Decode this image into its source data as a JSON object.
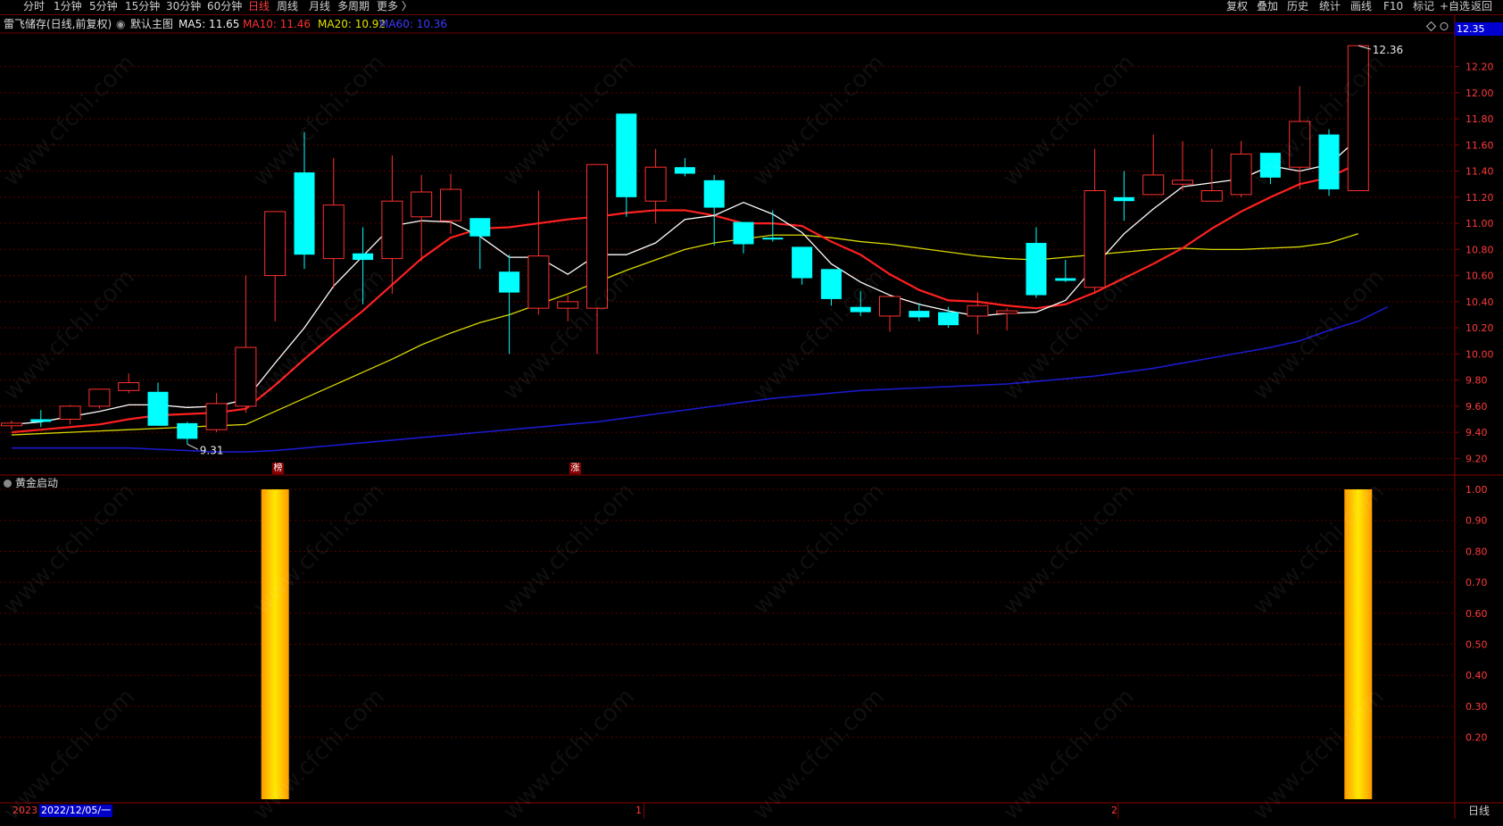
{
  "toolbar": {
    "periods": [
      "分时",
      "1分钟",
      "5分钟",
      "15分钟",
      "30分钟",
      "60分钟",
      "日线",
      "周线",
      "月线",
      "多周期",
      "更多 〉"
    ],
    "active_period": "日线",
    "right_buttons": [
      "复权",
      "叠加",
      "历史",
      "统计",
      "画线",
      "F10",
      "标记",
      "+自选",
      "返回"
    ]
  },
  "info": {
    "stock": "雷飞储存(日线,前复权)",
    "main_chart": "默认主图",
    "ma5": "MA5: 11.65",
    "ma10": "MA10: 11.46",
    "ma20": "MA20: 10.92",
    "ma60": "MA60: 10.36"
  },
  "current_price_box": "12.35",
  "annotations": {
    "high": "12.36",
    "low": "9.31"
  },
  "flags": [
    "榜",
    "涨"
  ],
  "sub_indicator": "黄金启动",
  "footer": {
    "year": "2023",
    "date": "2022/12/05/一",
    "month_1": "1",
    "month_2": "2",
    "period": "日线"
  },
  "colors": {
    "up": "#ff3030",
    "down": "#00ffff",
    "ma5": "#ffffff",
    "ma10": "#ff2020",
    "ma20": "#d8d800",
    "ma60": "#1a1acc",
    "bar": "#ffd000"
  },
  "watermark": "www.cfchi.com",
  "chart_data": [
    {
      "type": "candlestick",
      "y_ticks": [
        9.2,
        9.4,
        9.6,
        9.8,
        10.0,
        10.2,
        10.4,
        10.6,
        10.8,
        11.0,
        11.2,
        11.4,
        11.6,
        11.8,
        12.0,
        12.2
      ],
      "ylim": [
        9.1,
        12.45
      ],
      "candles": [
        {
          "o": 9.45,
          "h": 9.49,
          "l": 9.42,
          "c": 9.47
        },
        {
          "o": 9.5,
          "h": 9.57,
          "l": 9.44,
          "c": 9.48
        },
        {
          "o": 9.5,
          "h": 9.61,
          "l": 9.46,
          "c": 9.6
        },
        {
          "o": 9.6,
          "h": 9.73,
          "l": 9.58,
          "c": 9.73
        },
        {
          "o": 9.72,
          "h": 9.85,
          "l": 9.7,
          "c": 9.78
        },
        {
          "o": 9.71,
          "h": 9.78,
          "l": 9.45,
          "c": 9.45
        },
        {
          "o": 9.47,
          "h": 9.48,
          "l": 9.31,
          "c": 9.35
        },
        {
          "o": 9.42,
          "h": 9.7,
          "l": 9.4,
          "c": 9.62
        },
        {
          "o": 9.6,
          "h": 10.6,
          "l": 9.55,
          "c": 10.05
        },
        {
          "o": 10.6,
          "h": 11.09,
          "l": 10.25,
          "c": 11.09
        },
        {
          "o": 11.39,
          "h": 11.7,
          "l": 10.65,
          "c": 10.76
        },
        {
          "o": 10.73,
          "h": 11.5,
          "l": 10.5,
          "c": 11.14
        },
        {
          "o": 10.77,
          "h": 10.97,
          "l": 10.38,
          "c": 10.72
        },
        {
          "o": 10.73,
          "h": 11.52,
          "l": 10.46,
          "c": 11.17
        },
        {
          "o": 11.05,
          "h": 11.37,
          "l": 10.71,
          "c": 11.24
        },
        {
          "o": 11.02,
          "h": 11.38,
          "l": 10.92,
          "c": 11.26
        },
        {
          "o": 11.04,
          "h": 11.04,
          "l": 10.65,
          "c": 10.9
        },
        {
          "o": 10.63,
          "h": 10.76,
          "l": 10.0,
          "c": 10.47
        },
        {
          "o": 10.35,
          "h": 11.25,
          "l": 10.3,
          "c": 10.75
        },
        {
          "o": 10.35,
          "h": 10.45,
          "l": 10.25,
          "c": 10.4
        },
        {
          "o": 10.35,
          "h": 11.45,
          "l": 10.0,
          "c": 11.45
        },
        {
          "o": 11.84,
          "h": 11.84,
          "l": 11.05,
          "c": 11.2
        },
        {
          "o": 11.17,
          "h": 11.57,
          "l": 11.0,
          "c": 11.43
        },
        {
          "o": 11.43,
          "h": 11.5,
          "l": 11.36,
          "c": 11.38
        },
        {
          "o": 11.33,
          "h": 11.37,
          "l": 10.83,
          "c": 11.12
        },
        {
          "o": 11.01,
          "h": 11.01,
          "l": 10.77,
          "c": 10.84
        },
        {
          "o": 10.89,
          "h": 11.1,
          "l": 10.86,
          "c": 10.88
        },
        {
          "o": 10.82,
          "h": 10.82,
          "l": 10.53,
          "c": 10.58
        },
        {
          "o": 10.65,
          "h": 10.65,
          "l": 10.37,
          "c": 10.42
        },
        {
          "o": 10.36,
          "h": 10.48,
          "l": 10.29,
          "c": 10.32
        },
        {
          "o": 10.29,
          "h": 10.44,
          "l": 10.17,
          "c": 10.44
        },
        {
          "o": 10.33,
          "h": 10.39,
          "l": 10.25,
          "c": 10.28
        },
        {
          "o": 10.32,
          "h": 10.36,
          "l": 10.2,
          "c": 10.22
        },
        {
          "o": 10.29,
          "h": 10.47,
          "l": 10.15,
          "c": 10.37
        },
        {
          "o": 10.31,
          "h": 10.35,
          "l": 10.18,
          "c": 10.33
        },
        {
          "o": 10.85,
          "h": 10.97,
          "l": 10.43,
          "c": 10.45
        },
        {
          "o": 10.58,
          "h": 10.72,
          "l": 10.55,
          "c": 10.56
        },
        {
          "o": 10.51,
          "h": 11.57,
          "l": 10.46,
          "c": 11.25
        },
        {
          "o": 11.2,
          "h": 11.4,
          "l": 11.02,
          "c": 11.17
        },
        {
          "o": 11.22,
          "h": 11.68,
          "l": 11.22,
          "c": 11.37
        },
        {
          "o": 11.3,
          "h": 11.63,
          "l": 11.25,
          "c": 11.33
        },
        {
          "o": 11.17,
          "h": 11.57,
          "l": 11.17,
          "c": 11.25
        },
        {
          "o": 11.22,
          "h": 11.63,
          "l": 11.2,
          "c": 11.53
        },
        {
          "o": 11.54,
          "h": 11.54,
          "l": 11.3,
          "c": 11.35
        },
        {
          "o": 11.43,
          "h": 12.05,
          "l": 11.26,
          "c": 11.78
        },
        {
          "o": 11.68,
          "h": 11.72,
          "l": 11.21,
          "c": 11.26
        },
        {
          "o": 11.25,
          "h": 12.36,
          "l": 11.25,
          "c": 12.36
        }
      ],
      "ma5": [
        9.46,
        9.48,
        9.52,
        9.56,
        9.61,
        9.61,
        9.59,
        9.6,
        9.65,
        9.93,
        10.2,
        10.52,
        10.75,
        10.98,
        11.02,
        11.01,
        10.9,
        10.74,
        10.74,
        10.61,
        10.76,
        10.76,
        10.85,
        11.03,
        11.06,
        11.16,
        11.07,
        10.93,
        10.69,
        10.55,
        10.45,
        10.38,
        10.33,
        10.29,
        10.31,
        10.32,
        10.41,
        10.67,
        10.92,
        11.11,
        11.28,
        11.31,
        11.34,
        11.44,
        11.4,
        11.45,
        11.65
      ],
      "ma10": [
        9.4,
        9.42,
        9.44,
        9.46,
        9.5,
        9.53,
        9.54,
        9.55,
        9.58,
        9.76,
        9.96,
        10.15,
        10.33,
        10.53,
        10.73,
        10.89,
        10.96,
        10.97,
        11.0,
        11.03,
        11.05,
        11.08,
        11.1,
        11.1,
        11.06,
        11.0,
        11.0,
        10.98,
        10.86,
        10.76,
        10.61,
        10.49,
        10.41,
        10.4,
        10.37,
        10.35,
        10.38,
        10.47,
        10.58,
        10.69,
        10.81,
        10.96,
        11.09,
        11.2,
        11.3,
        11.35,
        11.46
      ],
      "ma20": [
        9.38,
        9.39,
        9.4,
        9.41,
        9.42,
        9.43,
        9.44,
        9.45,
        9.46,
        9.56,
        9.66,
        9.76,
        9.86,
        9.96,
        10.07,
        10.16,
        10.24,
        10.3,
        10.38,
        10.46,
        10.55,
        10.64,
        10.72,
        10.8,
        10.85,
        10.88,
        10.91,
        10.91,
        10.89,
        10.86,
        10.84,
        10.81,
        10.78,
        10.75,
        10.73,
        10.72,
        10.74,
        10.76,
        10.78,
        10.8,
        10.81,
        10.8,
        10.8,
        10.81,
        10.82,
        10.85,
        10.92
      ],
      "ma60": [
        9.28,
        9.28,
        9.28,
        9.28,
        9.28,
        9.27,
        9.26,
        9.25,
        9.25,
        9.26,
        9.28,
        9.3,
        9.32,
        9.34,
        9.36,
        9.38,
        9.4,
        9.42,
        9.44,
        9.46,
        9.48,
        9.51,
        9.54,
        9.57,
        9.6,
        9.63,
        9.66,
        9.68,
        9.7,
        9.72,
        9.73,
        9.74,
        9.75,
        9.76,
        9.77,
        9.79,
        9.81,
        9.83,
        9.86,
        9.89,
        9.93,
        9.97,
        10.01,
        10.05,
        10.1,
        10.18,
        10.25,
        10.36
      ]
    },
    {
      "type": "bar",
      "name": "黄金启动",
      "y_ticks": [
        0.2,
        0.3,
        0.4,
        0.5,
        0.6,
        0.7,
        0.8,
        0.9,
        1.0
      ],
      "ylim": [
        0,
        1.0
      ],
      "signals": {
        "9": 1.0,
        "46": 1.0
      }
    }
  ]
}
